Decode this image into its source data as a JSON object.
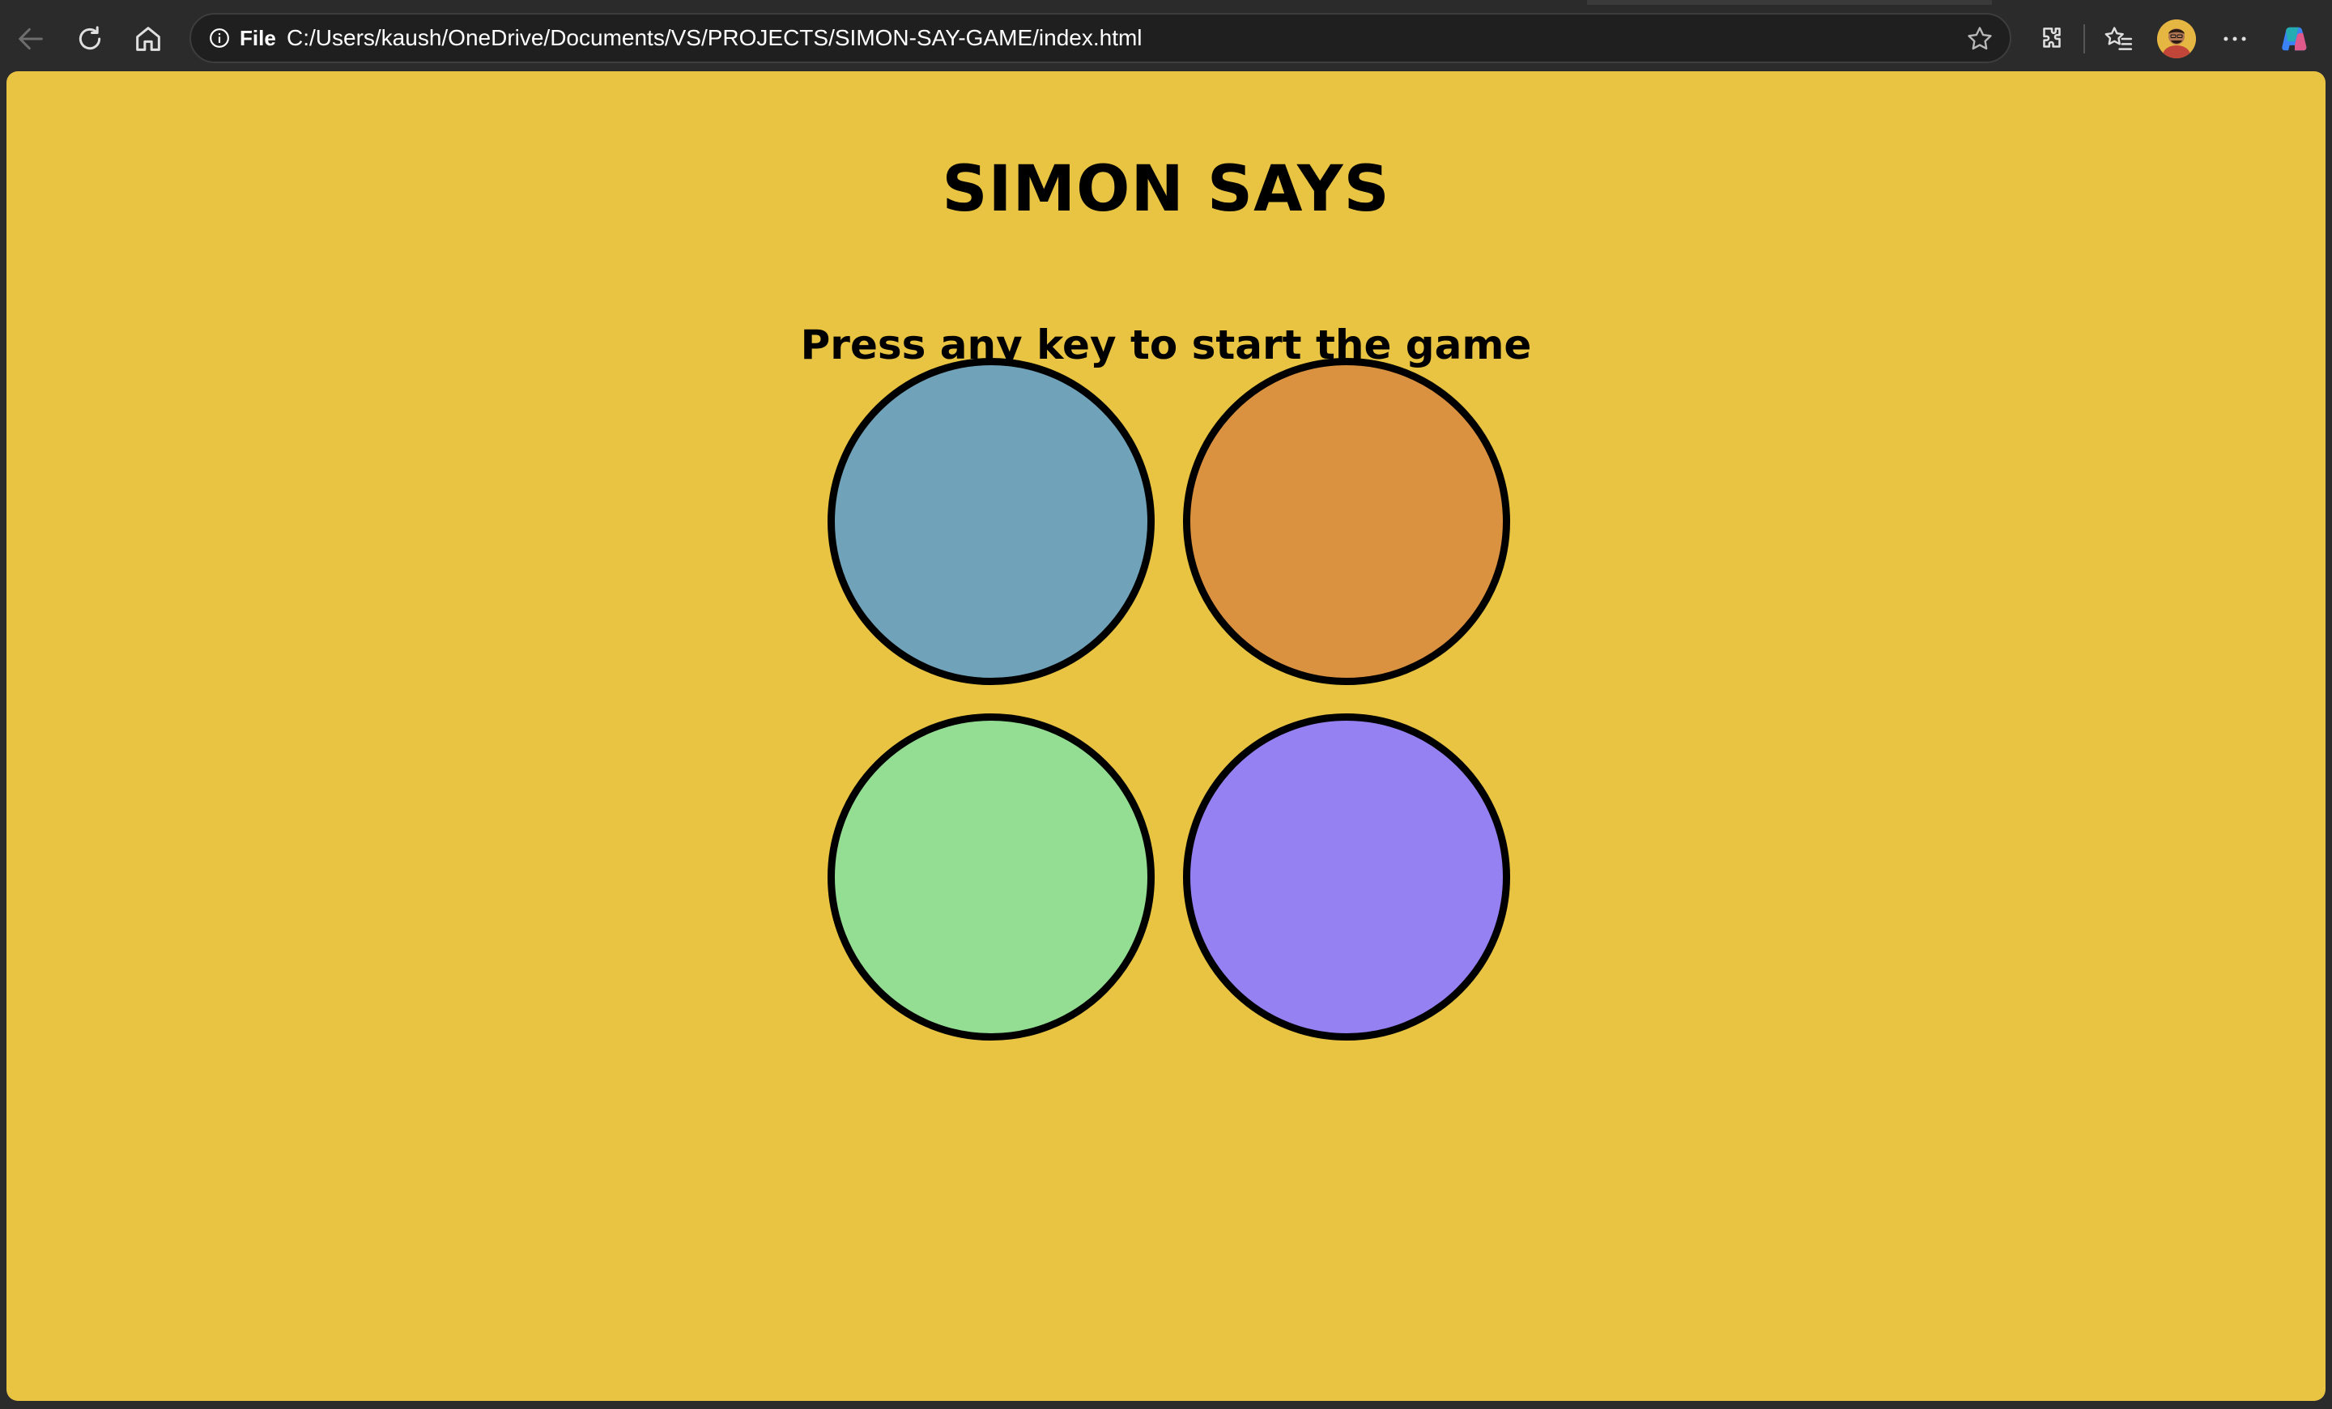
{
  "browser": {
    "site_info_label": "File",
    "url": "C:/Users/kaush/OneDrive/Documents/VS/PROJECTS/SIMON-SAY-GAME/index.html",
    "icons": {
      "back": "back-arrow-icon",
      "refresh": "refresh-icon",
      "home": "home-icon",
      "info": "info-icon",
      "favorite": "star-icon",
      "extensions": "puzzle-icon",
      "favorites": "favorites-list-icon",
      "profile": "avatar",
      "more": "more-dots-icon",
      "copilot": "copilot-icon"
    }
  },
  "page": {
    "title": "SIMON SAYS",
    "status": "Press any key to start the game",
    "background_color": "#e9c443",
    "buttons": [
      {
        "id": "blue",
        "color": "#70a2b9"
      },
      {
        "id": "orange",
        "color": "#db9240"
      },
      {
        "id": "green",
        "color": "#94de94"
      },
      {
        "id": "purple",
        "color": "#9681f2"
      }
    ]
  }
}
